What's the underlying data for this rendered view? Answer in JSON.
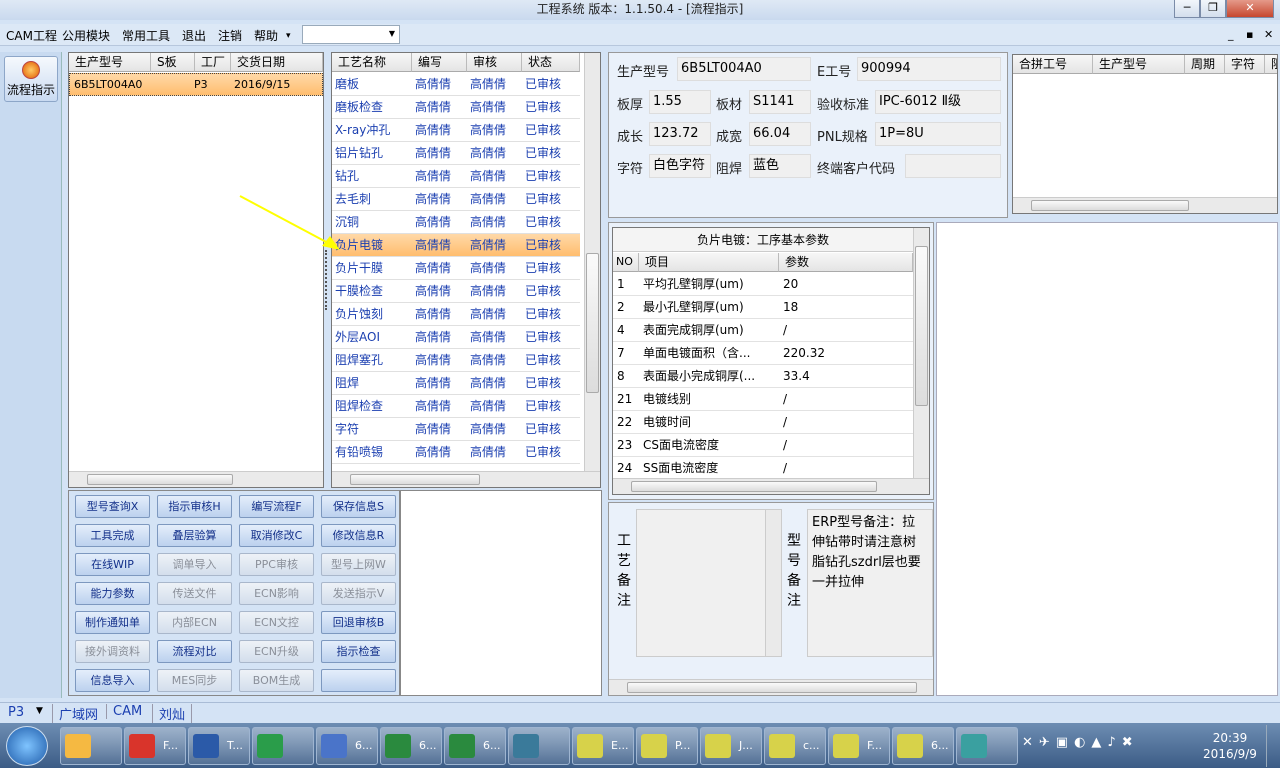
{
  "window": {
    "title": "工程系统  版本：1.1.50.4 - [流程指示]",
    "min": "─",
    "restore": "❐",
    "close": "✕"
  },
  "menu": {
    "items": [
      "CAM工程",
      "公用模块",
      "常用工具",
      "退出",
      "注销",
      "帮助"
    ],
    "combo": "",
    "mdi_min": "_",
    "mdi_restore": "▪",
    "mdi_close": "✕"
  },
  "leftbar": {
    "flow_label": "流程指示"
  },
  "orders": {
    "headers": [
      "生产型号",
      "S板",
      "工厂",
      "交货日期"
    ],
    "rows": [
      [
        "6B5LT004A0",
        "",
        "P3",
        "2016/9/15"
      ]
    ]
  },
  "process": {
    "headers": [
      "工艺名称",
      "编写",
      "审核",
      "状态"
    ],
    "selected_index": 7,
    "rows": [
      [
        "磨板",
        "高倩倩",
        "高倩倩",
        "已审核"
      ],
      [
        "磨板检查",
        "高倩倩",
        "高倩倩",
        "已审核"
      ],
      [
        "X-ray冲孔",
        "高倩倩",
        "高倩倩",
        "已审核"
      ],
      [
        "铝片钻孔",
        "高倩倩",
        "高倩倩",
        "已审核"
      ],
      [
        "钻孔",
        "高倩倩",
        "高倩倩",
        "已审核"
      ],
      [
        "去毛刺",
        "高倩倩",
        "高倩倩",
        "已审核"
      ],
      [
        "沉铜",
        "高倩倩",
        "高倩倩",
        "已审核"
      ],
      [
        "负片电镀",
        "高倩倩",
        "高倩倩",
        "已审核"
      ],
      [
        "负片干膜",
        "高倩倩",
        "高倩倩",
        "已审核"
      ],
      [
        "干膜检查",
        "高倩倩",
        "高倩倩",
        "已审核"
      ],
      [
        "负片蚀刻",
        "高倩倩",
        "高倩倩",
        "已审核"
      ],
      [
        "外层AOI",
        "高倩倩",
        "高倩倩",
        "已审核"
      ],
      [
        "阻焊塞孔",
        "高倩倩",
        "高倩倩",
        "已审核"
      ],
      [
        "阻焊",
        "高倩倩",
        "高倩倩",
        "已审核"
      ],
      [
        "阻焊检查",
        "高倩倩",
        "高倩倩",
        "已审核"
      ],
      [
        "字符",
        "高倩倩",
        "高倩倩",
        "已审核"
      ],
      [
        "有铅喷锡",
        "高倩倩",
        "高倩倩",
        "已审核"
      ]
    ]
  },
  "buttons": [
    {
      "label": "型号查询X",
      "enabled": true
    },
    {
      "label": "指示审核H",
      "enabled": true
    },
    {
      "label": "编写流程F",
      "enabled": true
    },
    {
      "label": "保存信息S",
      "enabled": true
    },
    {
      "label": "工具完成",
      "enabled": true
    },
    {
      "label": "叠层验算",
      "enabled": true
    },
    {
      "label": "取消修改C",
      "enabled": true
    },
    {
      "label": "修改信息R",
      "enabled": true
    },
    {
      "label": "在线WIP",
      "enabled": true
    },
    {
      "label": "调单导入",
      "enabled": false
    },
    {
      "label": "PPC审核",
      "enabled": false
    },
    {
      "label": "型号上网W",
      "enabled": false
    },
    {
      "label": "能力参数",
      "enabled": true
    },
    {
      "label": "传送文件",
      "enabled": false
    },
    {
      "label": "ECN影响",
      "enabled": false
    },
    {
      "label": "发送指示V",
      "enabled": false
    },
    {
      "label": "制作通知单",
      "enabled": true
    },
    {
      "label": "内部ECN",
      "enabled": false
    },
    {
      "label": "ECN文控",
      "enabled": false
    },
    {
      "label": "回退审核B",
      "enabled": true
    },
    {
      "label": "接外调资料",
      "enabled": false
    },
    {
      "label": "流程对比",
      "enabled": true
    },
    {
      "label": "ECN升级",
      "enabled": false
    },
    {
      "label": "指示检查",
      "enabled": true
    },
    {
      "label": "信息导入",
      "enabled": true
    },
    {
      "label": "MES同步",
      "enabled": false
    },
    {
      "label": "BOM生成",
      "enabled": false
    },
    {
      "label": "",
      "enabled": true
    }
  ],
  "info": {
    "l_model": "生产型号",
    "model": "6B5LT004A0",
    "l_e": "E工号",
    "e_no": "900994",
    "l_thick": "板厚",
    "thick": "1.55",
    "l_mat": "板材",
    "mat": "S1141",
    "l_std": "验收标准",
    "std": "IPC-6012 Ⅱ级",
    "l_len": "成长",
    "len": "123.72",
    "l_wid": "成宽",
    "wid": "66.04",
    "l_pnl": "PNL规格",
    "pnl": "1P=8U",
    "l_char": "字符",
    "char": "白色字符",
    "l_mask": "阻焊",
    "mask": "蓝色",
    "l_cust": "终端客户代码",
    "cust": ""
  },
  "merge": {
    "headers": [
      "合拼工号",
      "生产型号",
      "周期",
      "字符",
      "阻焊"
    ]
  },
  "params": {
    "title": "负片电镀：工序基本参数",
    "headers": [
      "NO",
      "项目",
      "参数"
    ],
    "rows": [
      [
        "1",
        "平均孔壁铜厚(um)",
        "20"
      ],
      [
        "2",
        "最小孔壁铜厚(um)",
        "18"
      ],
      [
        "4",
        "表面完成铜厚(um)",
        "/"
      ],
      [
        "7",
        "单面电镀面积（含...",
        "220.32"
      ],
      [
        "8",
        "表面最小完成铜厚(...",
        "33.4"
      ],
      [
        "21",
        "电镀线别",
        "/"
      ],
      [
        "22",
        "电镀时间",
        "/"
      ],
      [
        "23",
        "CS面电流密度",
        "/"
      ],
      [
        "24",
        "SS面电流密度",
        "/"
      ]
    ]
  },
  "notes": {
    "proc_label": "工艺备注",
    "model_label": "型号备注",
    "erp_note": "ERP型号备注：拉伸钻带时请注意树脂钻孔szdrl层也要一并拉伸"
  },
  "status": {
    "factory": "P3",
    "items": [
      "广域网",
      "CAM",
      "刘灿"
    ]
  },
  "taskbar": {
    "apps": [
      "",
      "F...",
      "T...",
      "",
      "6...",
      "6...",
      "6...",
      "",
      "E...",
      "P...",
      "J...",
      "c...",
      "F...",
      "6...",
      ""
    ],
    "time": "20:39",
    "date": "2016/9/9"
  },
  "colors": {
    "selected_row": "#ffbd6e",
    "link_text": "#1b3fb0",
    "arrow": "#ffff00"
  }
}
